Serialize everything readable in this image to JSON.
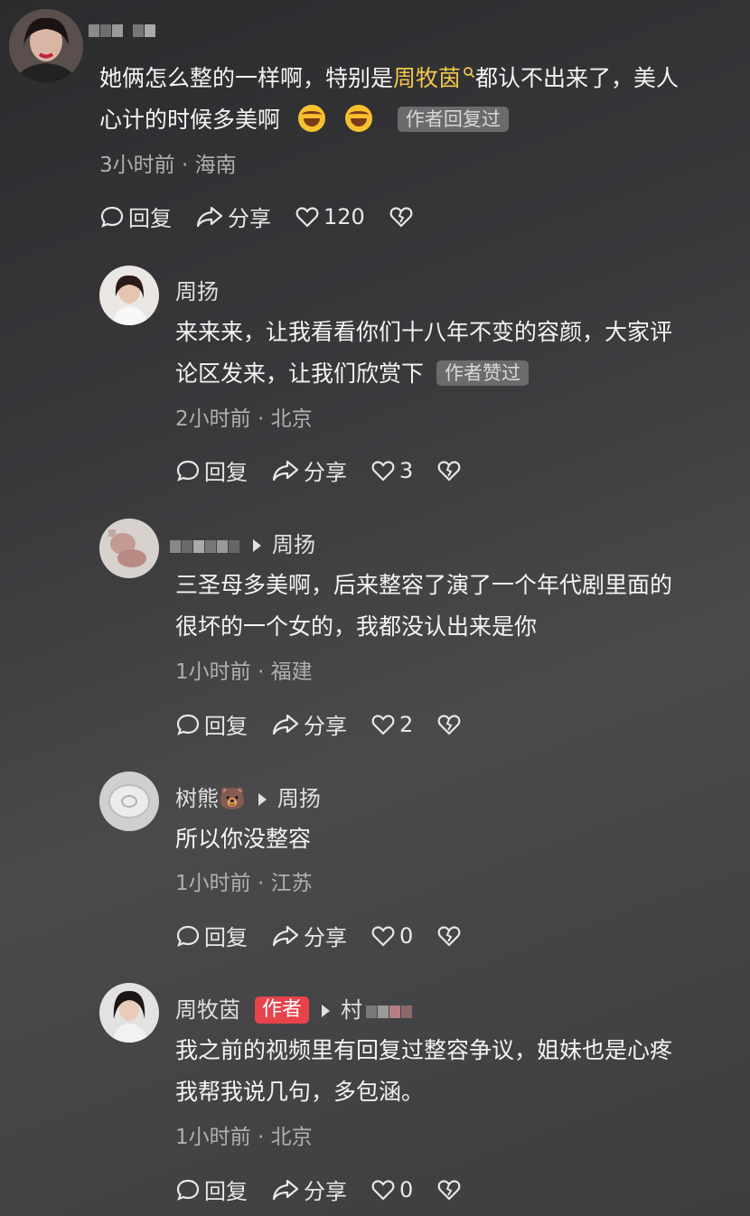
{
  "comments": [
    {
      "name_visible": "",
      "text_parts": [
        "她俩怎么整的一样啊，特别是",
        "周牧茵",
        "都认不出来了，美人",
        "心计的时候多美啊"
      ],
      "badge": "作者回复过",
      "meta": "3小时前 · 海南",
      "reply": "回复",
      "share": "分享",
      "likes": "120"
    },
    {
      "name": "周扬",
      "text_line1": "来来来，让我看看你们十八年不变的容颜，大家评",
      "text_line2": "论区发来，让我们欣赏下",
      "badge": "作者赞过",
      "meta": "2小时前 · 北京",
      "reply": "回复",
      "share": "分享",
      "likes": "3"
    },
    {
      "reply_to": "周扬",
      "text_line1": "三圣母多美啊，后来整容了演了一个年代剧里面的",
      "text_line2": "很坏的一个女的，我都没认出来是你",
      "meta": "1小时前 · 福建",
      "reply": "回复",
      "share": "分享",
      "likes": "2"
    },
    {
      "name": "树熊🐻",
      "reply_to": "周扬",
      "text_line1": "所以你没整容",
      "meta": "1小时前 · 江苏",
      "reply": "回复",
      "share": "分享",
      "likes": "0"
    },
    {
      "name": "周牧茵",
      "author_label": "作者",
      "reply_to_partial": "村",
      "text_line1": "我之前的视频里有回复过整容争议，姐妹也是心疼",
      "text_line2": "我帮我说几句，多包涵。",
      "meta": "1小时前 · 北京",
      "reply": "回复",
      "share": "分享",
      "likes": "0"
    }
  ],
  "colors": {
    "highlight": "#f2c84a",
    "author_tag": "#e8434a",
    "badge_bg": "#6b6b6e"
  }
}
